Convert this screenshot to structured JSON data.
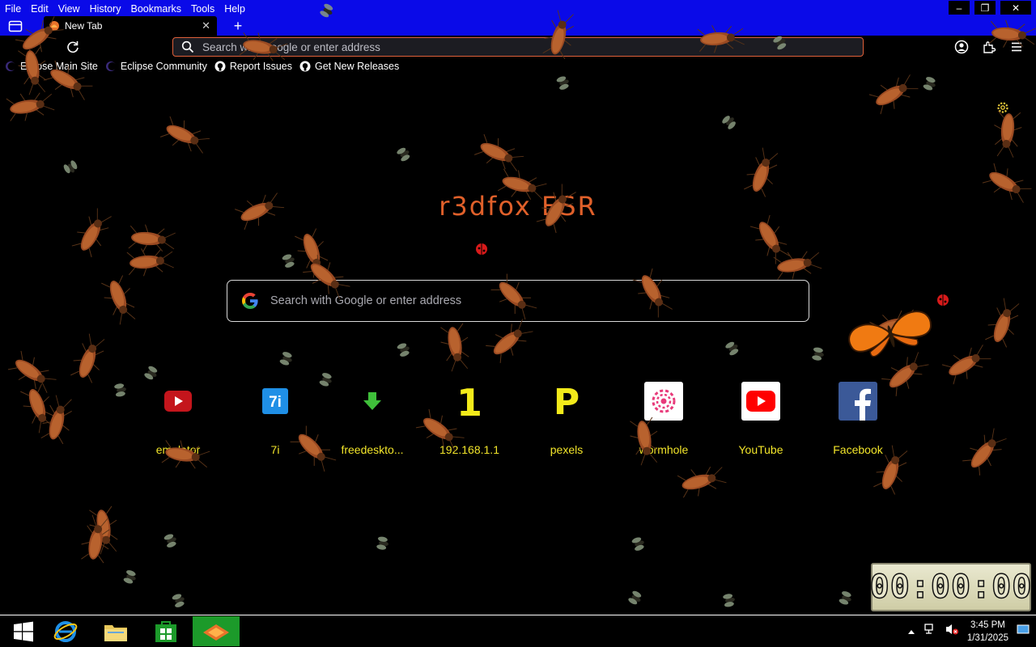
{
  "menubar": {
    "items": [
      "File",
      "Edit",
      "View",
      "History",
      "Bookmarks",
      "Tools",
      "Help"
    ]
  },
  "window_controls": {
    "minimize": "–",
    "restore": "❐",
    "close": "✕"
  },
  "tabs": [
    {
      "title": "New Tab",
      "close": "✕"
    }
  ],
  "new_tab_label": "+",
  "urlbar": {
    "placeholder": "Search with Google or enter address"
  },
  "bookmarks": [
    {
      "label": "Eclipse Main Site",
      "icon": "eclipse-icon"
    },
    {
      "label": "Eclipse Community",
      "icon": "eclipse-icon"
    },
    {
      "label": "Report Issues",
      "icon": "github-icon"
    },
    {
      "label": "Get New Releases",
      "icon": "github-icon"
    }
  ],
  "newtab": {
    "logo_text": "r3dfox ESR",
    "search_placeholder": "Search with Google or enter address",
    "top_sites": [
      {
        "label": "emulator",
        "icon": "youtube-red-icon"
      },
      {
        "label": "7i",
        "icon": "7i-icon"
      },
      {
        "label": "freedeskto...",
        "icon": "green-arrow-icon"
      },
      {
        "label": "192.168.1.1",
        "icon": "yellow-1-icon"
      },
      {
        "label": "pexels",
        "icon": "pexels-icon"
      },
      {
        "label": "wormhole",
        "icon": "wormhole-icon"
      },
      {
        "label": "YouTube",
        "icon": "youtube-icon"
      },
      {
        "label": "Facebook",
        "icon": "facebook-icon"
      }
    ]
  },
  "clock_widget": {
    "time": "00:00:00"
  },
  "taskbar": {
    "items": [
      "start-button",
      "internet-explorer-icon",
      "file-explorer-icon",
      "store-icon",
      "r3dfox-icon"
    ],
    "tray_time": "3:45 PM",
    "tray_date": "1/31/2025"
  },
  "colors": {
    "topbar": "#0a0ae8",
    "accent": "#e0603a",
    "tile_label": "#f2e52a",
    "taskbar_active": "#1c9a2a"
  }
}
